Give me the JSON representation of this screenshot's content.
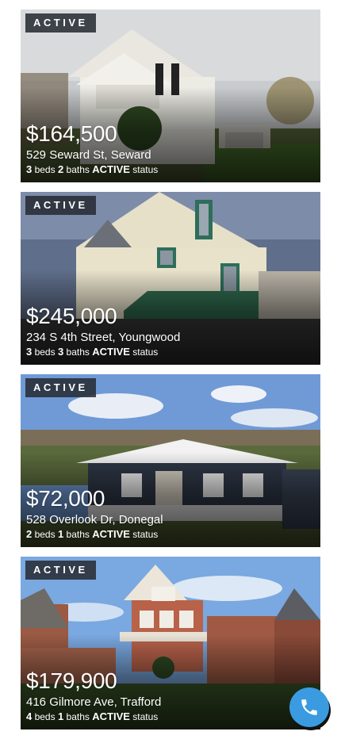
{
  "listings": [
    {
      "badge": "ACTIVE",
      "price": "$164,500",
      "address": "529 Seward St, Seward",
      "beds": "3",
      "beds_label": "beds",
      "baths": "2",
      "baths_label": "baths",
      "status": "ACTIVE",
      "status_label": "status"
    },
    {
      "badge": "ACTIVE",
      "price": "$245,000",
      "address": "234 S 4th Street, Youngwood",
      "beds": "3",
      "beds_label": "beds",
      "baths": "3",
      "baths_label": "baths",
      "status": "ACTIVE",
      "status_label": "status"
    },
    {
      "badge": "ACTIVE",
      "price": "$72,000",
      "address": "528 Overlook Dr, Donegal",
      "beds": "2",
      "beds_label": "beds",
      "baths": "1",
      "baths_label": "baths",
      "status": "ACTIVE",
      "status_label": "status"
    },
    {
      "badge": "ACTIVE",
      "price": "$179,900",
      "address": "416 Gilmore Ave, Trafford",
      "beds": "4",
      "beds_label": "beds",
      "baths": "1",
      "baths_label": "baths",
      "status": "ACTIVE",
      "status_label": "status"
    }
  ],
  "call_button": {
    "icon": "phone-icon",
    "color": "#3a9be0"
  }
}
